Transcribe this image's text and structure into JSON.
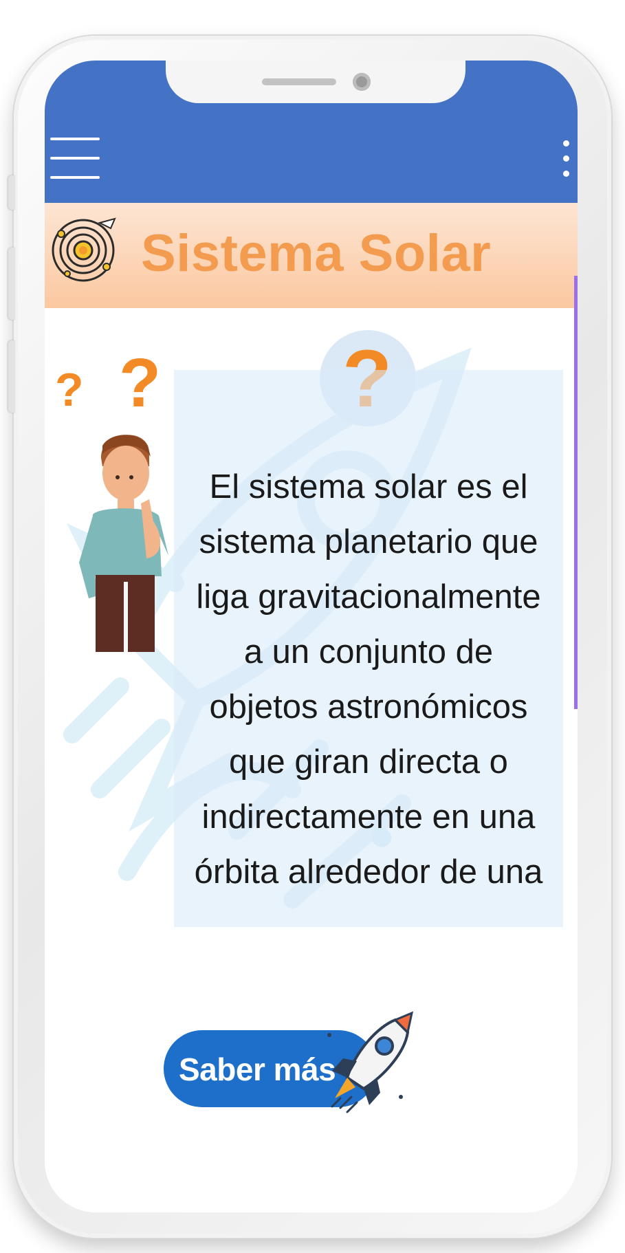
{
  "app": {
    "section_title": "Sistema Solar",
    "accent_color": "#4472c4",
    "header_color": "#fbc8a0",
    "title_color": "#f39b4f"
  },
  "topbar": {
    "menu_icon": "hamburger-menu-icon",
    "overflow_icon": "more-vertical-icon"
  },
  "logo": {
    "icon": "solar-system-orbit-icon"
  },
  "decor": {
    "question_mark": "?",
    "person_icon": "thinking-person-icon",
    "background_icon": "rocket-outline-icon"
  },
  "content": {
    "text_lines": [
      "El sistema solar es el",
      "sistema planetario que",
      "liga gravitacionalmente",
      "a un conjunto de",
      "objetos astronómicos",
      "que giran directa o",
      "indirectamente en una",
      "órbita alrededor de una"
    ]
  },
  "cta": {
    "label": "Saber más",
    "icon": "rocket-icon",
    "color": "#1d6fc9"
  }
}
